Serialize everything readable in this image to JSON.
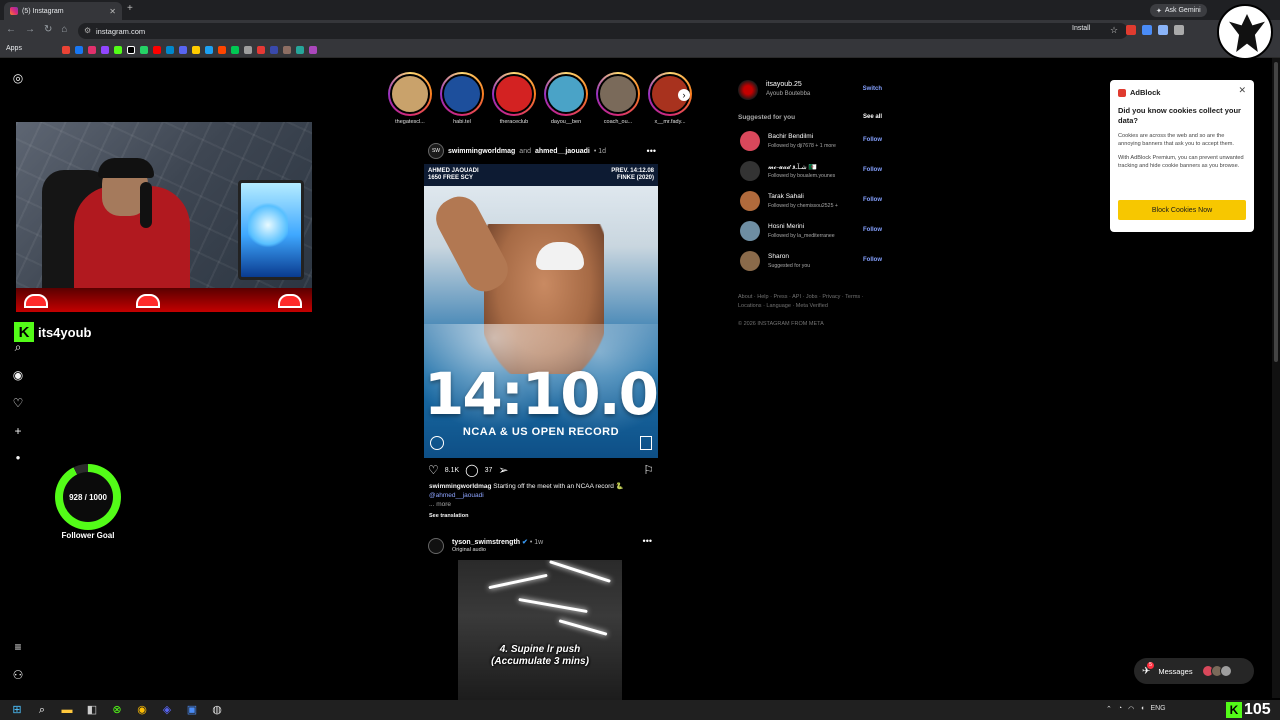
{
  "browser": {
    "tab_title": "(5) Instagram",
    "url": "instagram.com",
    "install_label": "Install",
    "ask_gemini": "Ask Gemini",
    "bookmarks_apps": "Apps"
  },
  "stories": [
    {
      "name": "thegatescl...",
      "color": "#c9a26b"
    },
    {
      "name": "habi.tel",
      "color": "#1d4f9c"
    },
    {
      "name": "theraceclub",
      "color": "#d32222"
    },
    {
      "name": "dayou__ben",
      "color": "#4aa3c7"
    },
    {
      "name": "coach_ou...",
      "color": "#7a6a5a"
    },
    {
      "name": "x__mr.fady...",
      "color": "#a8321e"
    }
  ],
  "post1": {
    "author": "swimmingworldmag",
    "and": "and",
    "coauthor": "ahmed__jaouadi",
    "time": "• 1d",
    "image": {
      "top_left": [
        "AHMED JAOUADI",
        "1650 FREE SCY"
      ],
      "top_right": [
        "PREV. 14:12.08",
        "FINKE (2020)"
      ],
      "big": "14:10.03",
      "sub": "NCAA & US OPEN RECORD"
    },
    "likes": "8.1K",
    "comments": "37",
    "caption_user": "swimmingworldmag",
    "caption": "Starting off the meet with an NCAA record 🐍",
    "mention": "@ahmed__jaouadi",
    "more": "... more",
    "translation": "See translation"
  },
  "post2": {
    "author": "tyson_swimstrength",
    "verified": "✔",
    "time": "• 1w",
    "audio": "Original audio",
    "overlay_line1": "4. Supine lr push",
    "overlay_line2": "(Accumulate 3 mins)"
  },
  "profile": {
    "username": "itsayoub.25",
    "name": "Ayoub Boutebba",
    "switch": "Switch"
  },
  "suggested": {
    "title": "Suggested for you",
    "see_all": "See all",
    "items": [
      {
        "name": "Bachir Bendilmi",
        "sub": "Followed by dji7678 + 1 more",
        "follow": "Follow",
        "color": "#d9485b"
      },
      {
        "name": "𝓶𝓸-𝓾𝓪𝓭 شـآـﻗ 🇩🇿",
        "sub": "Followed by boualem.younes",
        "follow": "Follow",
        "color": "#333333"
      },
      {
        "name": "Tarak Sahali",
        "sub": "Followed by chemissou2525 +",
        "follow": "Follow",
        "color": "#b06a3c"
      },
      {
        "name": "Hosni Merini",
        "sub": "Followed by la_mediterranee",
        "follow": "Follow",
        "color": "#6e8ea3"
      },
      {
        "name": "Sharon",
        "sub": "Suggested for you",
        "follow": "Follow",
        "color": "#8a6a4a"
      }
    ]
  },
  "footer": {
    "links": "About · Help · Press · API · Jobs · Privacy · Terms · Locations · Language · Meta Verified",
    "copyright": "© 2026 INSTAGRAM FROM META"
  },
  "adblock": {
    "brand": "AdBlock",
    "question": "Did you know cookies collect your data?",
    "p1": "Cookies are across the web and so are the annoying banners that ask you to accept them.",
    "p2": "With AdBlock Premium, you can prevent unwanted tracking and hide cookie banners as you browse.",
    "button": "Block Cookies Now"
  },
  "stream": {
    "username": "its4youb",
    "goal": "928 / 1000",
    "goal_fraction": 0.928,
    "goal_label": "Follower Goal",
    "viewer_count": "105",
    "accent": "#53fc18"
  },
  "messages": {
    "label": "Messages",
    "badge": "5"
  },
  "taskbar": {
    "lang": "ENG"
  }
}
